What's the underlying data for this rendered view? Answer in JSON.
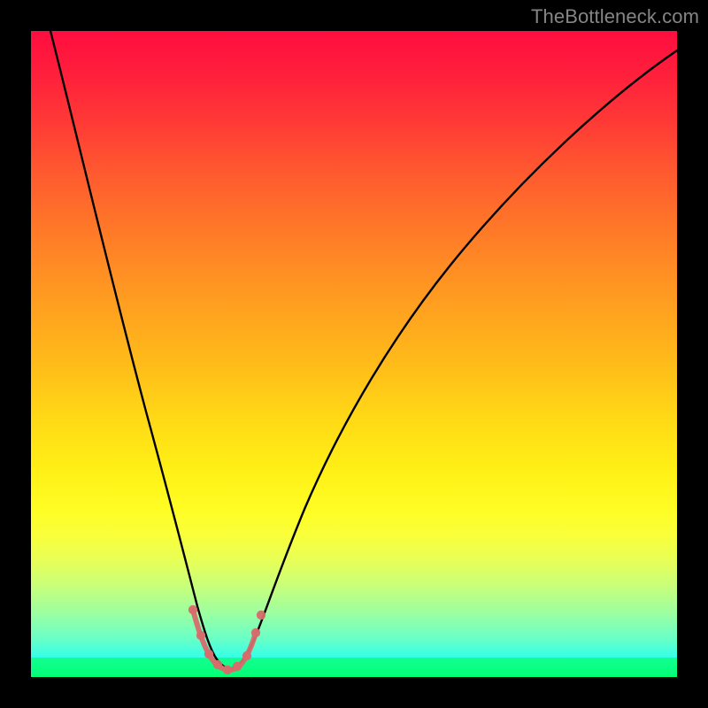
{
  "watermark": "TheBottleneck.com",
  "colors": {
    "background": "#000000",
    "curve": "#000000",
    "markers": "#d76c6c",
    "gradient_top": "#ff0e3f",
    "gradient_bottom": "#00f9ff",
    "green_band": "#07ff7d"
  },
  "chart_data": {
    "type": "line",
    "title": "",
    "xlabel": "",
    "ylabel": "",
    "xlim": [
      0,
      100
    ],
    "ylim": [
      0,
      100
    ],
    "grid": false,
    "series": [
      {
        "name": "bottleneck-curve",
        "x": [
          3,
          6,
          9,
          12,
          15,
          18,
          20,
          22,
          24,
          25,
          26,
          27,
          28,
          29,
          30,
          31,
          32,
          33,
          35,
          38,
          42,
          48,
          55,
          62,
          70,
          80,
          90,
          100
        ],
        "y": [
          100,
          88,
          76,
          64,
          52,
          40,
          32,
          24,
          16,
          11,
          7,
          4,
          2,
          1,
          0.5,
          1,
          2,
          4,
          9,
          18,
          30,
          44,
          56,
          66,
          74,
          82,
          88,
          93
        ]
      }
    ],
    "annotations": [
      {
        "name": "optimal-region-trough",
        "type": "highlight-points",
        "x": [
          24.5,
          25.5,
          27,
          28,
          29,
          30,
          31,
          32.5,
          33.5
        ],
        "y": [
          12,
          8,
          4,
          2,
          1,
          0.5,
          1,
          2.5,
          6
        ],
        "color": "#d76c6c"
      }
    ]
  }
}
